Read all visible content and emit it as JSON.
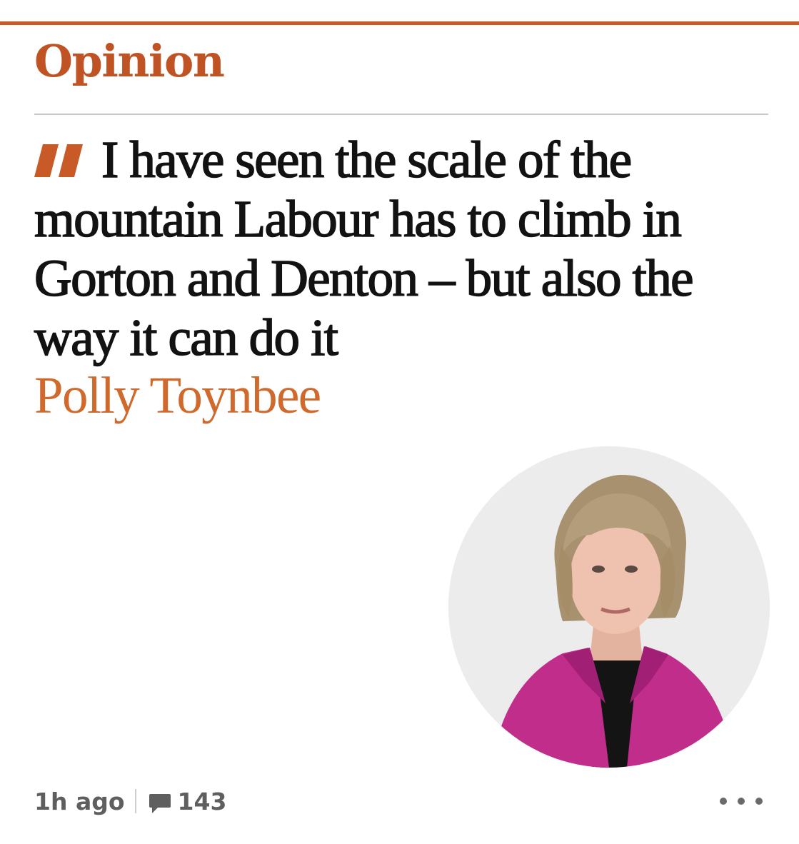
{
  "section": {
    "label": "Opinion",
    "accent_color": "#c05324"
  },
  "article": {
    "headline": "I have seen the scale of the mountain Labour has to climb in Gorton and Denton – but also the way it can do it",
    "author": "Polly Toynbee",
    "author_color": "#d0692c",
    "quote_icon": "quote-mark-icon",
    "avatar_description_icon": "author-portrait"
  },
  "meta": {
    "time_ago": "1h ago",
    "comment_icon": "comment-bubble-icon",
    "comment_count": "143",
    "more_icon": "more-options-icon"
  }
}
